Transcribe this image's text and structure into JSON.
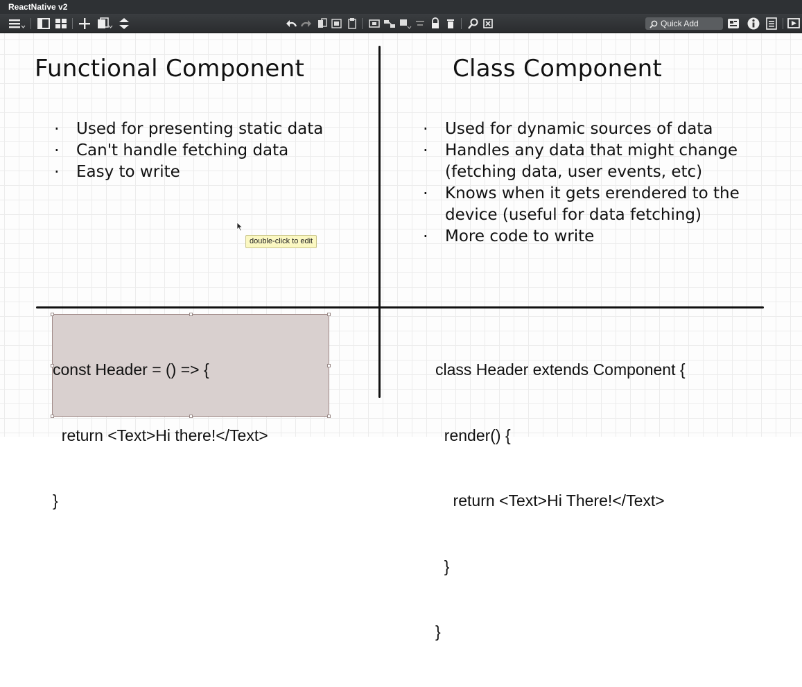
{
  "window": {
    "title": "ReactNative v2"
  },
  "toolbar": {
    "quick_add_label": "Quick Add",
    "icons": [
      "menu-icon",
      "single-view-icon",
      "grid-view-icon",
      "add-icon",
      "duplicate-icon",
      "arrange-icon",
      "undo-icon",
      "redo-icon",
      "copy-icon",
      "paste-icon",
      "clipboard-icon",
      "frame-icon",
      "connect-icon",
      "shadow-icon",
      "align-icon",
      "lock-icon",
      "delete-icon",
      "search-icon",
      "close-box-icon",
      "note-icon",
      "info-icon",
      "list-icon",
      "present-icon"
    ]
  },
  "canvas": {
    "left": {
      "heading": "Functional Component",
      "bullets": [
        "Used for presenting static data",
        "Can't handle fetching data",
        "Easy to write"
      ],
      "code": [
        "const Header = () => {",
        "  return <Text>Hi there!</Text>",
        "}"
      ]
    },
    "right": {
      "heading": "Class Component",
      "bullets": [
        "Used for dynamic sources of data",
        "Handles any data that might change\n(fetching data, user events, etc)",
        "Knows when it gets erendered to the\ndevice (useful for data fetching)",
        "More code to write"
      ],
      "code": [
        "class Header extends Component {",
        "  render() {",
        "    return <Text>Hi There!</Text>",
        "  }",
        "}"
      ]
    },
    "tooltip": "double-click to edit"
  },
  "colors": {
    "toolbar_bg": "#2e3134",
    "selection_fill": "#d9d0cf",
    "tooltip_bg": "#fbf8c2"
  }
}
